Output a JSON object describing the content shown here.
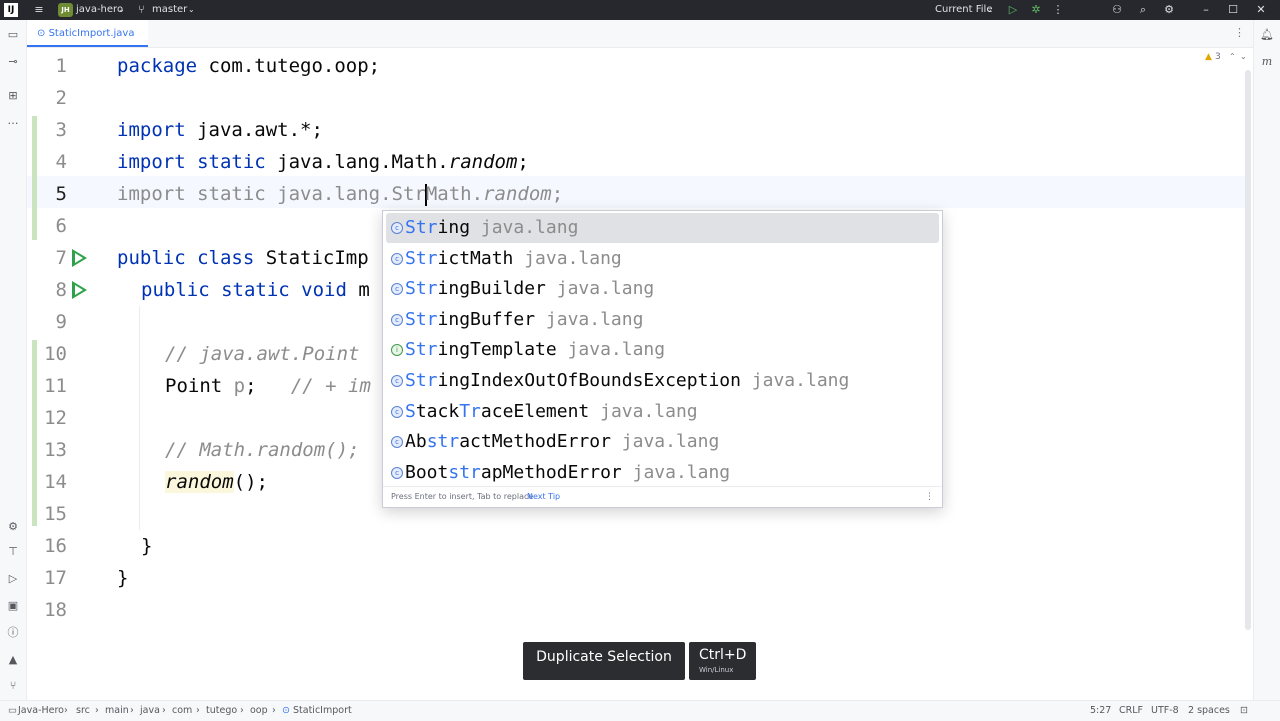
{
  "titlebar": {
    "project_badge": "JH",
    "project_name": "java-hero",
    "branch": "master",
    "run_config": "Current File"
  },
  "tab": {
    "label": "StaticImport.java"
  },
  "inspections": {
    "warnings": "3"
  },
  "right_panel": {
    "label": "m"
  },
  "editor": {
    "line_numbers": [
      "1",
      "2",
      "3",
      "4",
      "5",
      "6",
      "7",
      "8",
      "9",
      "10",
      "11",
      "12",
      "13",
      "14",
      "15",
      "16",
      "17",
      "18"
    ]
  },
  "completion": {
    "items": [
      {
        "match": "Str",
        "rest": "ing",
        "pkg": "java.lang"
      },
      {
        "match": "Str",
        "rest": "ictMath",
        "pkg": "java.lang"
      },
      {
        "match": "Str",
        "rest": "ingBuilder",
        "pkg": "java.lang"
      },
      {
        "match": "Str",
        "rest": "ingBuffer",
        "pkg": "java.lang"
      },
      {
        "match": "Str",
        "rest": "ingTemplate",
        "pkg": "java.lang"
      },
      {
        "match": "Str",
        "rest": "ingIndexOutOfBoundsException",
        "pkg": "java.lang"
      },
      {
        "pre": "",
        "match": "S",
        "mid": "tack",
        "match2": "Tr",
        "rest": "aceElement",
        "pkg": "java.lang"
      },
      {
        "pre": "Ab",
        "match": "str",
        "rest": "actMethodError",
        "pkg": "java.lang"
      },
      {
        "pre": "Boot",
        "match": "str",
        "rest": "apMethodError",
        "pkg": "java.lang"
      }
    ],
    "hint": "Press Enter to insert, Tab to replace",
    "next_tip": "Next Tip"
  },
  "keycast": {
    "action": "Duplicate Selection",
    "shortcut": "Ctrl+D",
    "platform": "Win/Linux"
  },
  "breadcrumb": [
    "Java-Hero",
    "src",
    "main",
    "java",
    "com",
    "tutego",
    "oop",
    "StaticImport"
  ],
  "status": {
    "position": "5:27",
    "line_sep": "CRLF",
    "encoding": "UTF-8",
    "indent": "2 spaces"
  }
}
